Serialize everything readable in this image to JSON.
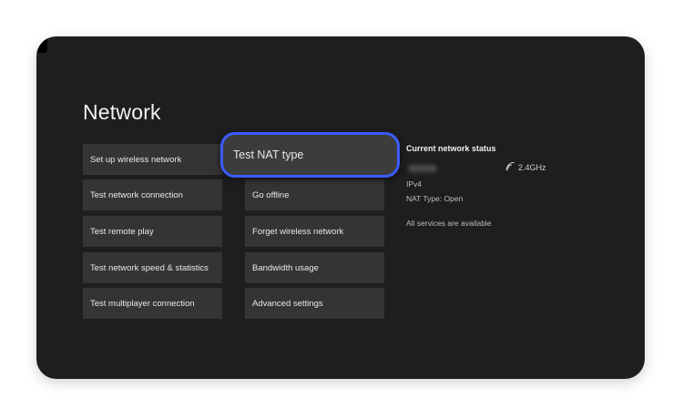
{
  "page": {
    "title": "Network"
  },
  "left_column": [
    {
      "label": "Set up wireless network"
    },
    {
      "label": "Test network connection"
    },
    {
      "label": "Test remote play"
    },
    {
      "label": "Test network speed & statistics"
    },
    {
      "label": "Test multiplayer connection"
    }
  ],
  "right_column": [
    {
      "label": "Test NAT type",
      "focused": true
    },
    {
      "label": "Go offline"
    },
    {
      "label": "Forget wireless network"
    },
    {
      "label": "Bandwidth usage"
    },
    {
      "label": "Advanced settings"
    }
  ],
  "status": {
    "heading": "Current network status",
    "band": "2.4GHz",
    "band_icon": "wifi-signal-icon",
    "protocol": "IPv4",
    "nat_type": "NAT Type: Open",
    "services": "All services are available"
  },
  "colors": {
    "focus_ring": "#3b5cff",
    "background": "#1e1e1e",
    "tile": "#343434"
  }
}
